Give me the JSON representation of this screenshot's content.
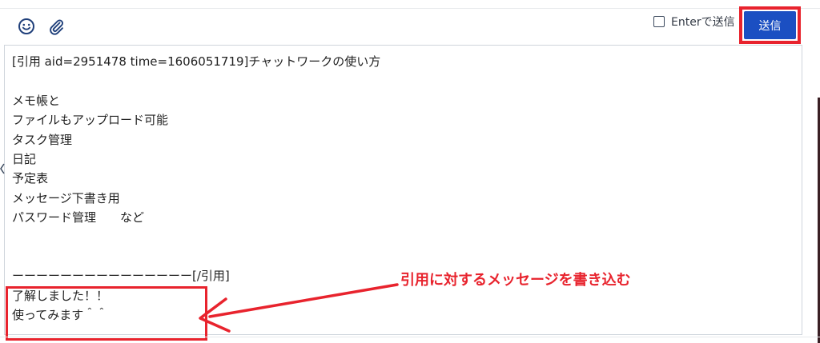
{
  "toolbar": {
    "emoji_icon": "smiley-icon",
    "attach_icon": "paperclip-icon",
    "enter_to_send": {
      "label": "Enterで送信",
      "checked": false
    },
    "send_label": "送信"
  },
  "message": {
    "lines": [
      "[引用 aid=2951478 time=1606051719]チャットワークの使い方",
      "",
      "メモ帳と",
      "ファイルもアップロード可能",
      "タスク管理",
      "日記",
      "予定表",
      "メッセージ下書き用",
      "パスワード管理　　など",
      "",
      "",
      "ーーーーーーーーーーーーーーー[/引用]",
      "了解しました！！",
      "使ってみます＾＾"
    ]
  },
  "annotation": {
    "text": "引用に対するメッセージを書き込む"
  },
  "colors": {
    "send_button": "#1b4fc2",
    "highlight_red": "#e8232d",
    "border": "#cfd5dc",
    "icon": "#1f3f7a"
  }
}
